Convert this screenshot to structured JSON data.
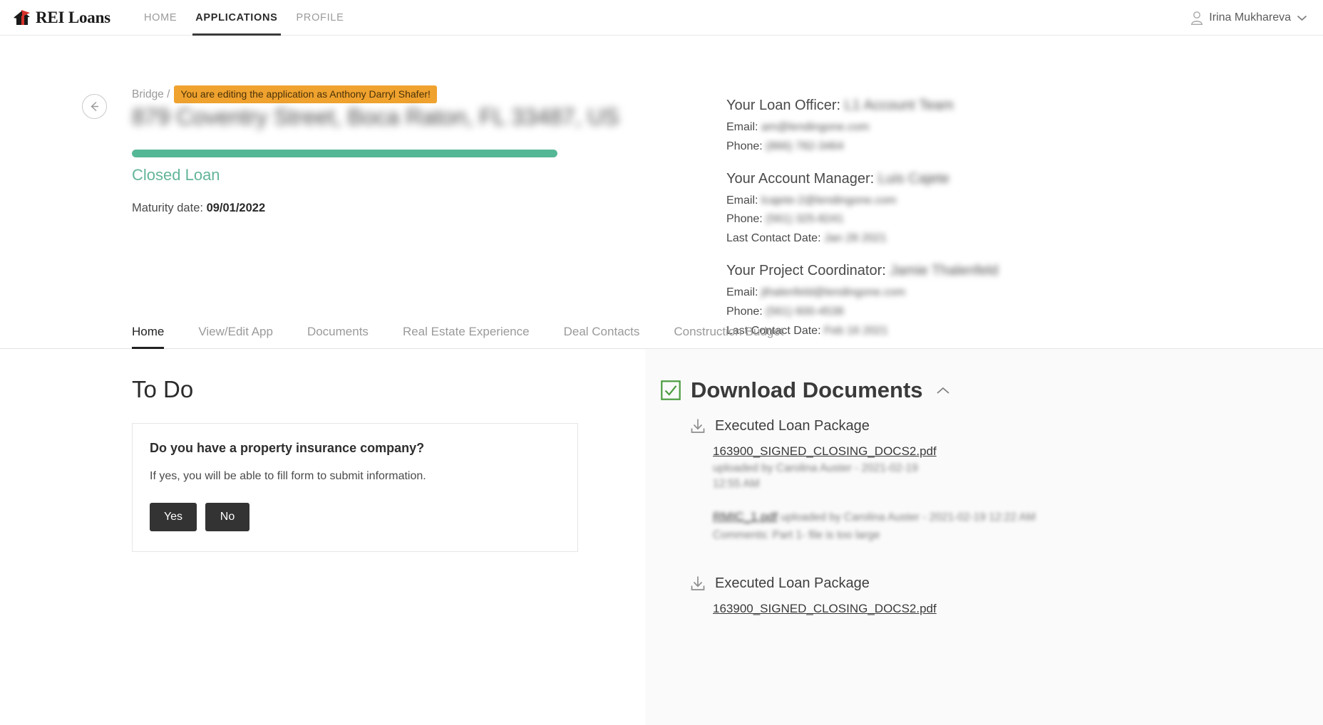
{
  "nav": {
    "brand": "REI Loans",
    "brand_icon": "house-flag-logo",
    "links": [
      {
        "label": "HOME",
        "active": false
      },
      {
        "label": "APPLICATIONS",
        "active": true
      },
      {
        "label": "PROFILE",
        "active": false
      }
    ],
    "user": {
      "name": "Irina Mukhareva",
      "icon": "user-icon",
      "chevron": "chevron-down-icon"
    }
  },
  "header": {
    "back_icon": "arrow-left-icon",
    "breadcrumb": "Bridge /",
    "edit_badge": "You are editing the application as Anthony Darryl Shafer!",
    "deal_title": "879 Coventry Street, Boca Raton, FL 33487, US",
    "progress_percent": 100,
    "progress_color": "#54b796",
    "loan_status": "Closed Loan",
    "loan_status_color": "#63b59a",
    "maturity_label": "Maturity date:",
    "maturity_value": "09/01/2022"
  },
  "contacts": [
    {
      "role_label": "Your Loan Officer:",
      "name": "L1 Account Team",
      "rows": [
        {
          "label": "Email:",
          "value": "am@lendingone.com"
        },
        {
          "label": "Phone:",
          "value": "(866) 782-3464"
        }
      ]
    },
    {
      "role_label": "Your Account Manager:",
      "name": "Luis Cajete",
      "rows": [
        {
          "label": "Email:",
          "value": "lcajete-2@lendingone.com"
        },
        {
          "label": "Phone:",
          "value": "(561) 325-8241"
        },
        {
          "label": "Last Contact Date:",
          "value": "Jan 28 2021"
        }
      ]
    },
    {
      "role_label": "Your Project Coordinator:",
      "name": "Jamie Thalenfeld",
      "rows": [
        {
          "label": "Email:",
          "value": "jthalenfeld@lendingone.com"
        },
        {
          "label": "Phone:",
          "value": "(561) 600-4538"
        },
        {
          "label": "Last Contact Date:",
          "value": "Feb 16 2021"
        }
      ]
    }
  ],
  "tabs": [
    {
      "label": "Home",
      "active": true
    },
    {
      "label": "View/Edit App",
      "active": false
    },
    {
      "label": "Documents",
      "active": false
    },
    {
      "label": "Real Estate Experience",
      "active": false
    },
    {
      "label": "Deal Contacts",
      "active": false
    },
    {
      "label": "Construction Budget",
      "active": false
    }
  ],
  "todo": {
    "title": "To Do",
    "question": "Do you have a property insurance company?",
    "subtext": "If yes, you will be able to fill form to submit information.",
    "yes_label": "Yes",
    "no_label": "No"
  },
  "download_documents": {
    "title": "Download Documents",
    "check_icon": "checkbox-checked-icon",
    "collapse_icon": "chevron-up-icon",
    "check_color": "#4a9c3f",
    "groups": [
      {
        "label": "Executed Loan Package",
        "icon": "download-icon",
        "files": [
          {
            "name": "163900_SIGNED_CLOSING_DOCS2.pdf",
            "meta": "uploaded by Carolina Auster - 2021-02-19 12:55 AM"
          },
          {
            "name": "RMIC_1.pdf",
            "meta": "uploaded by Carolina Auster - 2021-02-19 12:22 AM",
            "comment": "Comments: Part 1- file is too large"
          }
        ]
      },
      {
        "label": "Executed Loan Package",
        "icon": "download-icon",
        "files": [
          {
            "name": "163900_SIGNED_CLOSING_DOCS2.pdf",
            "meta": ""
          }
        ]
      }
    ]
  }
}
